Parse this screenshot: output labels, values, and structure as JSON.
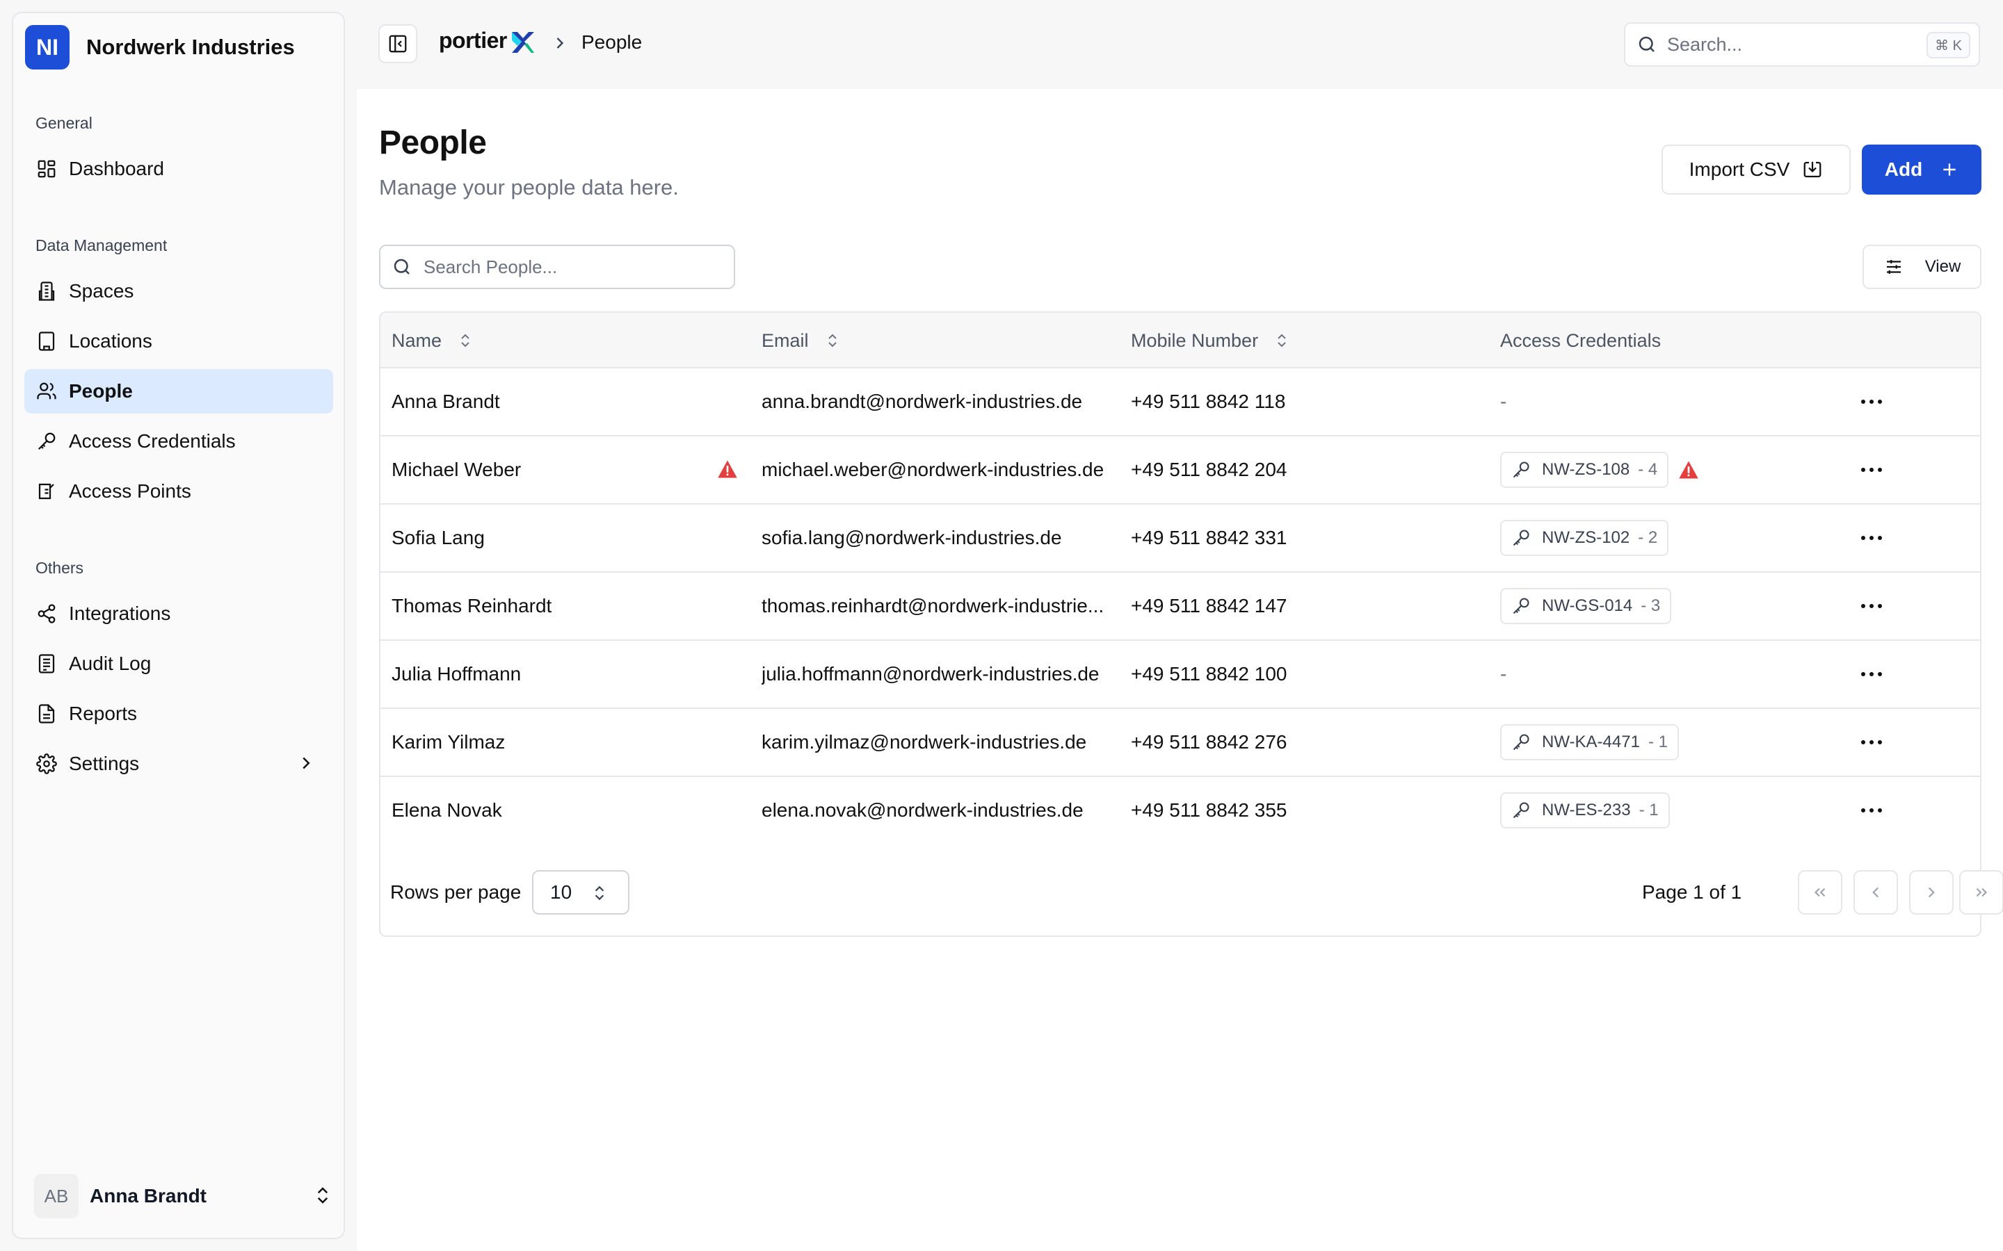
{
  "org": {
    "initials": "NI",
    "name": "Nordwerk Industries"
  },
  "sidebar": {
    "sections": [
      {
        "label": "General"
      },
      {
        "label": "Data Management"
      },
      {
        "label": "Others"
      }
    ],
    "items": [
      {
        "label": "Dashboard",
        "icon": "dashboard-icon"
      },
      {
        "label": "Spaces",
        "icon": "building-icon"
      },
      {
        "label": "Locations",
        "icon": "buildings-icon"
      },
      {
        "label": "People",
        "icon": "users-icon",
        "active": true
      },
      {
        "label": "Access Credentials",
        "icon": "key-icon"
      },
      {
        "label": "Access Points",
        "icon": "door-icon"
      },
      {
        "label": "Integrations",
        "icon": "share-icon"
      },
      {
        "label": "Audit Log",
        "icon": "list-icon"
      },
      {
        "label": "Reports",
        "icon": "file-icon"
      },
      {
        "label": "Settings",
        "icon": "gear-icon"
      }
    ],
    "user": {
      "initials": "AB",
      "name": "Anna Brandt"
    }
  },
  "topbar": {
    "logo": "portier",
    "breadcrumb": "People",
    "search_placeholder": "Search...",
    "shortcut": "⌘ K"
  },
  "page": {
    "title": "People",
    "subtitle": "Manage your people data here.",
    "import_label": "Import CSV",
    "add_label": "Add",
    "search_placeholder": "Search People...",
    "view_label": "View"
  },
  "table": {
    "columns": [
      "Name",
      "Email",
      "Mobile Number",
      "Access Credentials"
    ],
    "rows": [
      {
        "name": "Anna Brandt",
        "email": "anna.brandt@nordwerk-industries.de",
        "mobile": "+49 511 8842 118",
        "cred": "-",
        "cred_count": "",
        "name_warning": false,
        "cred_warning": false
      },
      {
        "name": "Michael Weber",
        "email": "michael.weber@nordwerk-industries.de",
        "mobile": "+49 511 8842 204",
        "cred": "NW-ZS-108",
        "cred_count": "- 4",
        "name_warning": true,
        "cred_warning": true
      },
      {
        "name": "Sofia Lang",
        "email": "sofia.lang@nordwerk-industries.de",
        "mobile": "+49 511 8842 331",
        "cred": "NW-ZS-102",
        "cred_count": "- 2",
        "name_warning": false,
        "cred_warning": false
      },
      {
        "name": "Thomas Reinhardt",
        "email": "thomas.reinhardt@nordwerk-industrie...",
        "mobile": "+49 511 8842 147",
        "cred": "NW-GS-014",
        "cred_count": "- 3",
        "name_warning": false,
        "cred_warning": false
      },
      {
        "name": "Julia Hoffmann",
        "email": "julia.hoffmann@nordwerk-industries.de",
        "mobile": "+49 511 8842 100",
        "cred": "-",
        "cred_count": "",
        "name_warning": false,
        "cred_warning": false
      },
      {
        "name": "Karim Yilmaz",
        "email": "karim.yilmaz@nordwerk-industries.de",
        "mobile": "+49 511 8842 276",
        "cred": "NW-KA-4471",
        "cred_count": "- 1",
        "name_warning": false,
        "cred_warning": false
      },
      {
        "name": "Elena Novak",
        "email": "elena.novak@nordwerk-industries.de",
        "mobile": "+49 511 8842 355",
        "cred": "NW-ES-233",
        "cred_count": "- 1",
        "name_warning": false,
        "cred_warning": false
      }
    ]
  },
  "pagination": {
    "rows_per_page_label": "Rows per page",
    "rows_per_page": "10",
    "page_info": "Page 1 of 1"
  },
  "colors": {
    "accent": "#1d4ed8",
    "active_bg": "#dbeafe",
    "warning": "#e53e3e"
  }
}
